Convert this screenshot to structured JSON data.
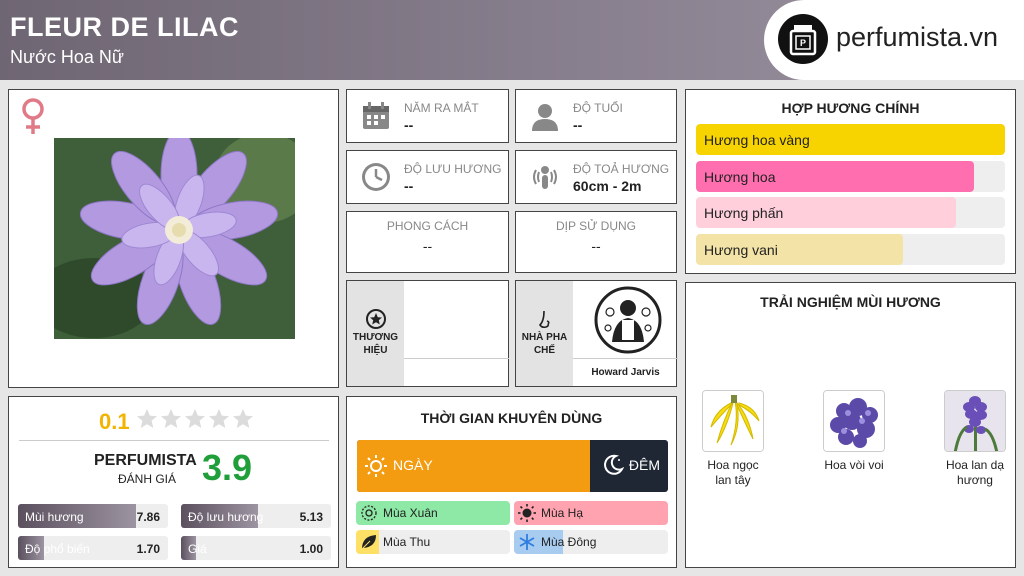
{
  "header": {
    "title": "FLEUR DE LILAC",
    "subtitle": "Nước Hoa Nữ",
    "logo_text": "perfumista.vn"
  },
  "gender": {
    "icon": "female-icon",
    "color": "#e07a86"
  },
  "stats": {
    "release_year": {
      "label": "NĂM RA MẮT",
      "value": "--",
      "icon": "calendar-icon"
    },
    "age": {
      "label": "ĐỘ TUỔI",
      "value": "--",
      "icon": "person-icon"
    },
    "longevity": {
      "label": "ĐỘ LƯU HƯƠNG",
      "value": "--",
      "icon": "clock-icon"
    },
    "sillage": {
      "label": "ĐỘ TOẢ HƯƠNG",
      "value": "60cm - 2m",
      "icon": "sillage-icon"
    },
    "style": {
      "label": "PHONG CÁCH",
      "value": "--"
    },
    "occasion": {
      "label": "DỊP SỬ DỤNG",
      "value": "--"
    }
  },
  "brand": {
    "label_line1": "THƯƠNG",
    "label_line2": "HIỆU",
    "icon": "star-badge-icon"
  },
  "perfumer": {
    "label_line1": "NHÀ PHA",
    "label_line2": "CHẾ",
    "name": "Howard Jarvis",
    "icon": "nose-icon"
  },
  "accords": {
    "title": "HỢP HƯƠNG CHÍNH",
    "items": [
      {
        "label": "Hương hoa vàng",
        "color": "#f7d400",
        "fill": 1.0
      },
      {
        "label": "Hương hoa",
        "color": "#ff6fb0",
        "fill": 0.9
      },
      {
        "label": "Hương phấn",
        "color": "#ffd0dc",
        "fill": 0.84
      },
      {
        "label": "Hương vani",
        "color": "#f3e3a7",
        "fill": 0.67
      }
    ]
  },
  "rating": {
    "score": "0.1",
    "stars_filled": 0,
    "stars_total": 5,
    "perfumista_label": "PERFUMISTA",
    "perfumista_sub": "ĐÁNH GIÁ",
    "perfumista_score": "3.9",
    "metrics": [
      {
        "label": "Mùi hương",
        "value": "7.86",
        "fill": 0.786
      },
      {
        "label": "Độ lưu hương",
        "value": "5.13",
        "fill": 0.513
      },
      {
        "label": "Độ phổ biến",
        "value": "1.70",
        "fill": 0.17
      },
      {
        "label": "Giá",
        "value": "1.00",
        "fill": 0.1
      }
    ]
  },
  "time": {
    "title": "THỜI GIAN KHUYÊN DÙNG",
    "day_label": "NGÀY",
    "night_label": "ĐÊM",
    "day_share": 0.75,
    "seasons": [
      {
        "label": "Mùa Xuân",
        "color": "#8ee8a6",
        "fill": 1.0,
        "icon": "spring-icon"
      },
      {
        "label": "Mùa Hạ",
        "color": "#ffa3b0",
        "fill": 1.0,
        "icon": "sun-icon"
      },
      {
        "label": "Mùa Thu",
        "color": "#ffe066",
        "fill": 0.15,
        "icon": "leaf-icon"
      },
      {
        "label": "Mùa Đông",
        "color": "#a8cbf0",
        "fill": 0.32,
        "icon": "snowflake-icon"
      }
    ]
  },
  "experience": {
    "title": "TRẢI NGHIỆM MÙI HƯƠNG",
    "notes": [
      {
        "label_line1": "Hoa ngọc",
        "label_line2": "lan tây"
      },
      {
        "label_line1": "Hoa vòi voi",
        "label_line2": ""
      },
      {
        "label_line1": "Hoa lan dạ",
        "label_line2": "hương"
      }
    ]
  }
}
